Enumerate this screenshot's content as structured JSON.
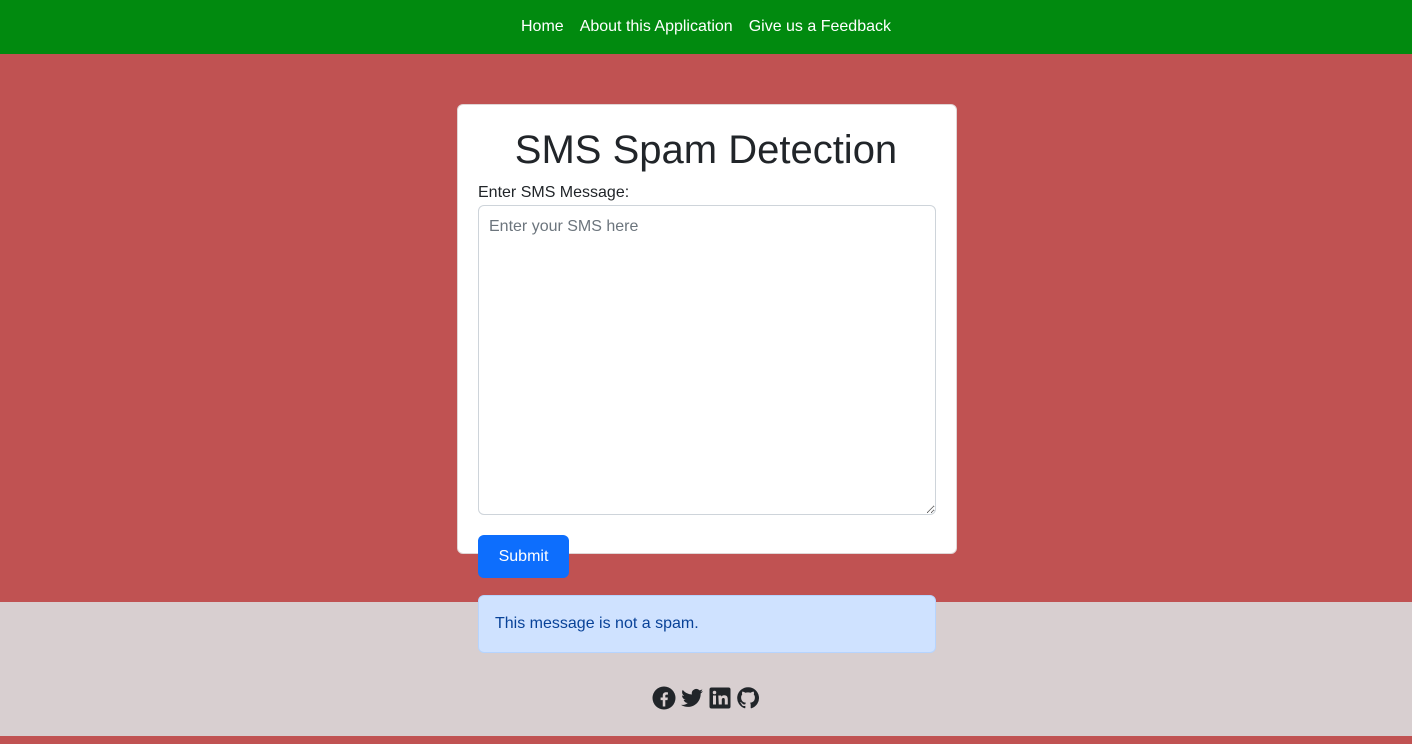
{
  "nav": {
    "links": [
      "Home",
      "About this Application",
      "Give us a Feedback"
    ],
    "bg_color": "#018a0f"
  },
  "page": {
    "bg_color": "#c05252"
  },
  "form": {
    "title": "SMS Spam Detection",
    "label": "Enter SMS Message:",
    "placeholder": "Enter your SMS here",
    "value": "",
    "submit_label": "Submit"
  },
  "result": {
    "message": "This message is not a spam."
  },
  "footer": {
    "social_icons": [
      "facebook-icon",
      "twitter-icon",
      "linkedin-icon",
      "github-icon"
    ]
  }
}
